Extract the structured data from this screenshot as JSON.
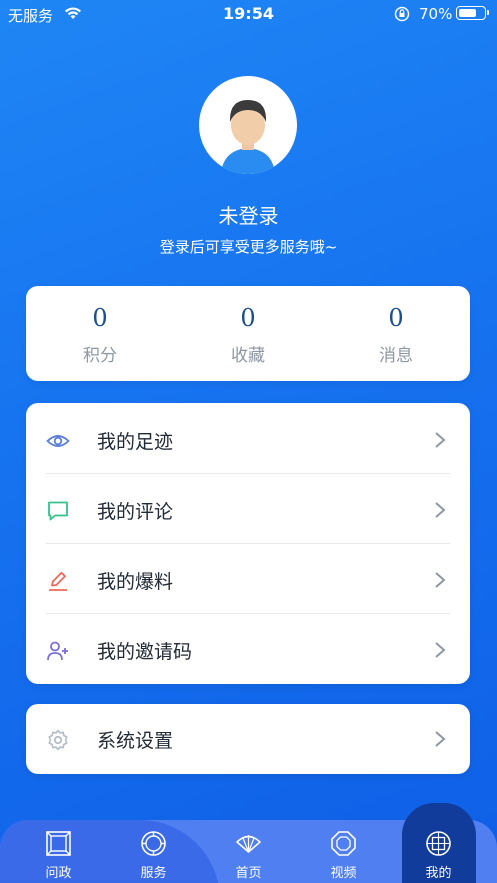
{
  "status_bar": {
    "carrier": "无服务",
    "time": "19:54",
    "battery_percent": "70%",
    "battery_level": 0.7
  },
  "profile": {
    "title": "未登录",
    "subtitle": "登录后可享受更多服务哦~"
  },
  "stats": [
    {
      "value": "0",
      "label": "积分"
    },
    {
      "value": "0",
      "label": "收藏"
    },
    {
      "value": "0",
      "label": "消息"
    }
  ],
  "menu": [
    {
      "label": "我的足迹",
      "icon": "eye-icon",
      "color": "#5b7fd6"
    },
    {
      "label": "我的评论",
      "icon": "comment-icon",
      "color": "#37c08a"
    },
    {
      "label": "我的爆料",
      "icon": "edit-icon",
      "color": "#f0685a"
    },
    {
      "label": "我的邀请码",
      "icon": "add-user-icon",
      "color": "#7b6fd9"
    }
  ],
  "settings": {
    "label": "系统设置",
    "icon": "gear-icon",
    "color": "#b5bcc6"
  },
  "tabs": [
    {
      "label": "问政",
      "icon": "frame-icon"
    },
    {
      "label": "服务",
      "icon": "circle-badge-icon"
    },
    {
      "label": "首页",
      "icon": "fan-icon"
    },
    {
      "label": "视频",
      "icon": "octagon-icon"
    },
    {
      "label": "我的",
      "icon": "lattice-icon",
      "active": true
    }
  ],
  "colors": {
    "background": "#1774f0",
    "stat_number": "#1b4f8c",
    "tab_active": "#123c9c"
  }
}
